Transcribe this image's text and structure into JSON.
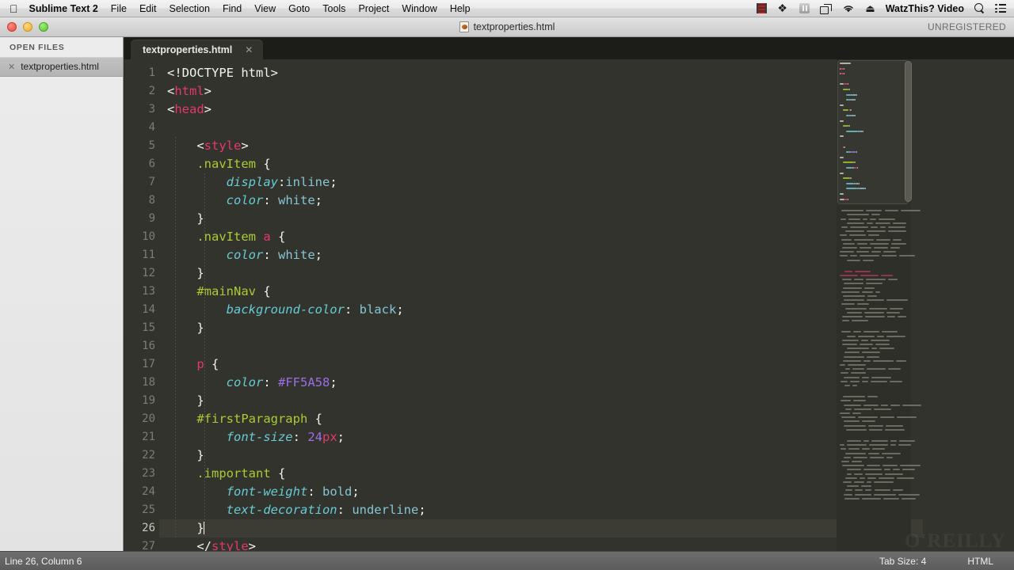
{
  "menubar": {
    "apple_icon": "apple-logo-icon",
    "app_name": "Sublime Text 2",
    "items": [
      "File",
      "Edit",
      "Selection",
      "Find",
      "View",
      "Goto",
      "Tools",
      "Project",
      "Window",
      "Help"
    ],
    "status_icons": [
      "screen-recording-icon",
      "dropbox-icon",
      "pause-icon",
      "display-mirroring-icon",
      "wifi-icon",
      "eject-icon"
    ],
    "user_name": "WatzThis? Video",
    "search_icon": "search-icon",
    "notification_icon": "notification-center-icon"
  },
  "titlebar": {
    "document_title": "textproperties.html",
    "document_icon": "html-file-icon",
    "registration_status": "UNREGISTERED",
    "close_label": "close",
    "minimize_label": "minimize",
    "zoom_label": "zoom"
  },
  "sidebar": {
    "header": "OPEN FILES",
    "files": [
      {
        "name": "textproperties.html",
        "close_icon": "close-file-icon",
        "selected": true
      }
    ]
  },
  "tabs": [
    {
      "label": "textproperties.html",
      "close_icon": "close-tab-icon",
      "active": true
    }
  ],
  "editor": {
    "active_line": 26,
    "cursor_line": 26,
    "cursor_column": 6,
    "first_visible_line": 1,
    "lines": [
      {
        "n": 1,
        "tokens": [
          {
            "t": "<!DOCTYPE html>",
            "c": "c-plain"
          }
        ]
      },
      {
        "n": 2,
        "tokens": [
          {
            "t": "<",
            "c": "c-punc"
          },
          {
            "t": "html",
            "c": "c-tag"
          },
          {
            "t": ">",
            "c": "c-punc"
          }
        ]
      },
      {
        "n": 3,
        "tokens": [
          {
            "t": "<",
            "c": "c-punc"
          },
          {
            "t": "head",
            "c": "c-tag"
          },
          {
            "t": ">",
            "c": "c-punc"
          }
        ]
      },
      {
        "n": 4,
        "tokens": []
      },
      {
        "n": 5,
        "tokens": [
          {
            "t": "    <",
            "c": "c-punc"
          },
          {
            "t": "style",
            "c": "c-tag"
          },
          {
            "t": ">",
            "c": "c-punc"
          }
        ]
      },
      {
        "n": 6,
        "tokens": [
          {
            "t": "    ",
            "c": "c-plain"
          },
          {
            "t": ".navItem",
            "c": "c-sel"
          },
          {
            "t": " {",
            "c": "c-punc"
          }
        ]
      },
      {
        "n": 7,
        "tokens": [
          {
            "t": "        ",
            "c": "c-plain"
          },
          {
            "t": "display",
            "c": "c-prop"
          },
          {
            "t": ":",
            "c": "c-punc"
          },
          {
            "t": "inline",
            "c": "c-val"
          },
          {
            "t": ";",
            "c": "c-punc"
          }
        ]
      },
      {
        "n": 8,
        "tokens": [
          {
            "t": "        ",
            "c": "c-plain"
          },
          {
            "t": "color",
            "c": "c-prop"
          },
          {
            "t": ": ",
            "c": "c-punc"
          },
          {
            "t": "white",
            "c": "c-val"
          },
          {
            "t": ";",
            "c": "c-punc"
          }
        ]
      },
      {
        "n": 9,
        "tokens": [
          {
            "t": "    }",
            "c": "c-punc"
          }
        ]
      },
      {
        "n": 10,
        "tokens": [
          {
            "t": "    ",
            "c": "c-plain"
          },
          {
            "t": ".navItem",
            "c": "c-sel"
          },
          {
            "t": " ",
            "c": "c-punc"
          },
          {
            "t": "a",
            "c": "c-unit"
          },
          {
            "t": " {",
            "c": "c-punc"
          }
        ]
      },
      {
        "n": 11,
        "tokens": [
          {
            "t": "        ",
            "c": "c-plain"
          },
          {
            "t": "color",
            "c": "c-prop"
          },
          {
            "t": ": ",
            "c": "c-punc"
          },
          {
            "t": "white",
            "c": "c-val"
          },
          {
            "t": ";",
            "c": "c-punc"
          }
        ]
      },
      {
        "n": 12,
        "tokens": [
          {
            "t": "    }",
            "c": "c-punc"
          }
        ]
      },
      {
        "n": 13,
        "tokens": [
          {
            "t": "    ",
            "c": "c-plain"
          },
          {
            "t": "#mainNav",
            "c": "c-sel"
          },
          {
            "t": " {",
            "c": "c-punc"
          }
        ]
      },
      {
        "n": 14,
        "tokens": [
          {
            "t": "        ",
            "c": "c-plain"
          },
          {
            "t": "background-color",
            "c": "c-prop"
          },
          {
            "t": ": ",
            "c": "c-punc"
          },
          {
            "t": "black",
            "c": "c-val"
          },
          {
            "t": ";",
            "c": "c-punc"
          }
        ]
      },
      {
        "n": 15,
        "tokens": [
          {
            "t": "    }",
            "c": "c-punc"
          }
        ]
      },
      {
        "n": 16,
        "tokens": []
      },
      {
        "n": 17,
        "tokens": [
          {
            "t": "    ",
            "c": "c-plain"
          },
          {
            "t": "p",
            "c": "c-unit"
          },
          {
            "t": " {",
            "c": "c-punc"
          }
        ]
      },
      {
        "n": 18,
        "tokens": [
          {
            "t": "        ",
            "c": "c-plain"
          },
          {
            "t": "color",
            "c": "c-prop"
          },
          {
            "t": ": ",
            "c": "c-punc"
          },
          {
            "t": "#FF5A58",
            "c": "c-num"
          },
          {
            "t": ";",
            "c": "c-punc"
          }
        ]
      },
      {
        "n": 19,
        "tokens": [
          {
            "t": "    }",
            "c": "c-punc"
          }
        ]
      },
      {
        "n": 20,
        "tokens": [
          {
            "t": "    ",
            "c": "c-plain"
          },
          {
            "t": "#firstParagraph",
            "c": "c-sel"
          },
          {
            "t": " {",
            "c": "c-punc"
          }
        ]
      },
      {
        "n": 21,
        "tokens": [
          {
            "t": "        ",
            "c": "c-plain"
          },
          {
            "t": "font-size",
            "c": "c-prop"
          },
          {
            "t": ": ",
            "c": "c-punc"
          },
          {
            "t": "24",
            "c": "c-num"
          },
          {
            "t": "px",
            "c": "c-unit"
          },
          {
            "t": ";",
            "c": "c-punc"
          }
        ]
      },
      {
        "n": 22,
        "tokens": [
          {
            "t": "    }",
            "c": "c-punc"
          }
        ]
      },
      {
        "n": 23,
        "tokens": [
          {
            "t": "    ",
            "c": "c-plain"
          },
          {
            "t": ".important",
            "c": "c-sel"
          },
          {
            "t": " {",
            "c": "c-punc"
          }
        ]
      },
      {
        "n": 24,
        "tokens": [
          {
            "t": "        ",
            "c": "c-plain"
          },
          {
            "t": "font-weight",
            "c": "c-prop"
          },
          {
            "t": ": ",
            "c": "c-punc"
          },
          {
            "t": "bold",
            "c": "c-val"
          },
          {
            "t": ";",
            "c": "c-punc"
          }
        ]
      },
      {
        "n": 25,
        "tokens": [
          {
            "t": "        ",
            "c": "c-plain"
          },
          {
            "t": "text-decoration",
            "c": "c-prop"
          },
          {
            "t": ": ",
            "c": "c-punc"
          },
          {
            "t": "underline",
            "c": "c-val"
          },
          {
            "t": ";",
            "c": "c-punc"
          }
        ]
      },
      {
        "n": 26,
        "tokens": [
          {
            "t": "    }",
            "c": "c-punc"
          }
        ],
        "caret_after": true
      },
      {
        "n": 27,
        "tokens": [
          {
            "t": "    </",
            "c": "c-punc"
          },
          {
            "t": "style",
            "c": "c-tag"
          },
          {
            "t": ">",
            "c": "c-punc"
          }
        ]
      }
    ]
  },
  "statusbar": {
    "position": "Line 26, Column 6",
    "tab_size": "Tab Size: 4",
    "syntax": "HTML"
  },
  "watermark": {
    "text": "O'REILLY"
  },
  "colors": {
    "editor_background": "#33332d",
    "selector": "#aacb33",
    "property": "#66cbd4",
    "value": "#86c5d6",
    "tag": "#e4386c",
    "number": "#9b6ee8",
    "plain_text": "#f4f4ee",
    "active_line": "#3c3c34"
  }
}
